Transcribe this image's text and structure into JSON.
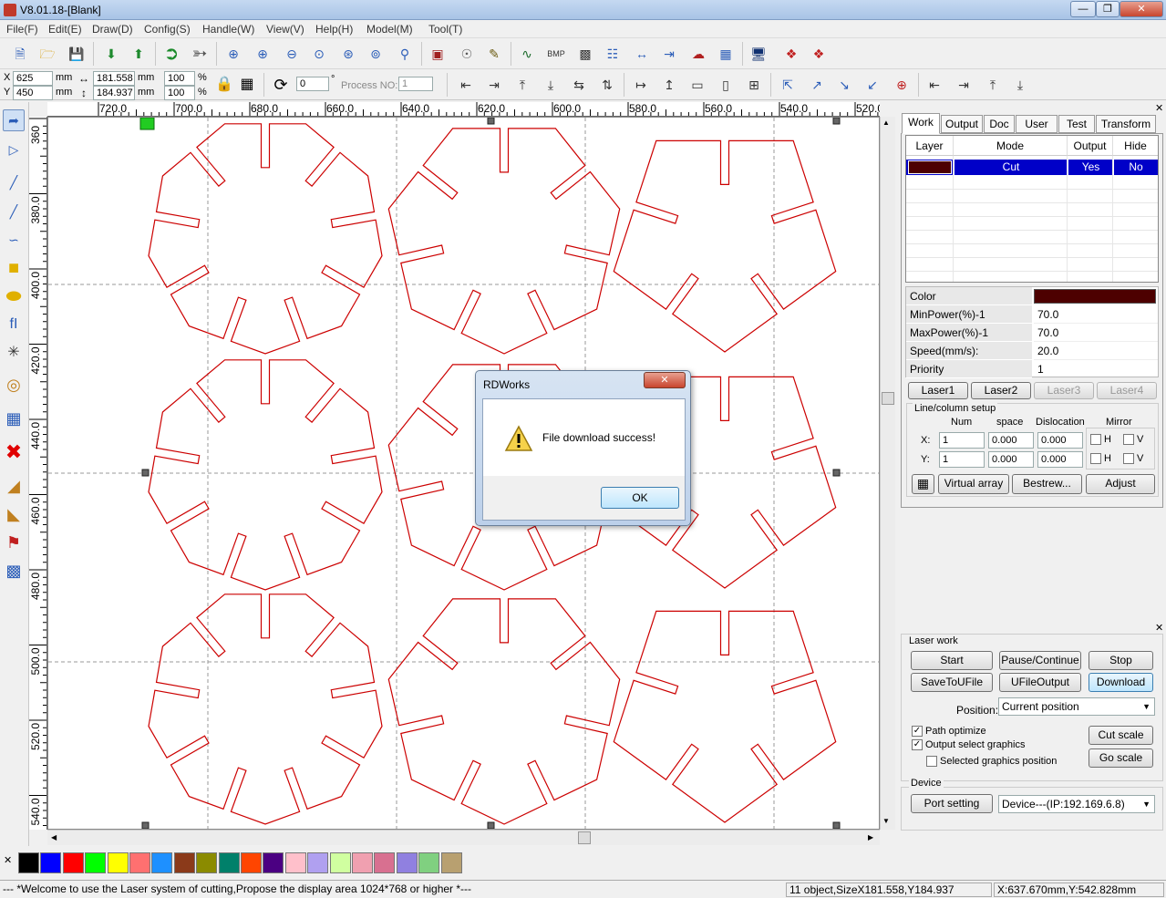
{
  "window": {
    "title": "V8.01.18-[Blank]"
  },
  "menu": [
    "File(F)",
    "Edit(E)",
    "Draw(D)",
    "Config(S)",
    "Handle(W)",
    "View(V)",
    "Help(H)",
    "Model(M)",
    "Tool(T)"
  ],
  "coords": {
    "x_label": "X",
    "x_value": "625",
    "x_unit": "mm",
    "y_label": "Y",
    "y_value": "450",
    "y_unit": "mm",
    "w_value": "181.558",
    "w_unit": "mm",
    "h_value": "184.937",
    "h_unit": "mm",
    "sx_value": "100",
    "sx_unit": "%",
    "sy_value": "100",
    "sy_unit": "%",
    "rotate_value": "0",
    "rotate_unit": "°",
    "process_label": "Process NO:",
    "process_value": "1"
  },
  "ruler_top": [
    "720.0",
    "700.0",
    "680.0",
    "660.0",
    "640.0",
    "620.0",
    "600.0",
    "580.0",
    "560.0",
    "540.0",
    "520.0"
  ],
  "ruler_left": [
    "360",
    "380.0",
    "400.0",
    "420.0",
    "440.0",
    "460.0",
    "480.0",
    "500.0",
    "520.0",
    "540.0"
  ],
  "tabs": [
    "Work",
    "Output",
    "Doc",
    "User",
    "Test",
    "Transform"
  ],
  "layer_table": {
    "headers": [
      "Layer",
      "Mode",
      "Output",
      "Hide"
    ],
    "row": {
      "color": "#4d0000",
      "mode": "Cut",
      "output": "Yes",
      "hide": "No"
    }
  },
  "props": [
    {
      "label": "Color",
      "value": ""
    },
    {
      "label": "MinPower(%)-1",
      "value": "70.0"
    },
    {
      "label": "MaxPower(%)-1",
      "value": "70.0"
    },
    {
      "label": "Speed(mm/s):",
      "value": "20.0"
    },
    {
      "label": "Priority",
      "value": "1"
    }
  ],
  "laser_buttons": [
    "Laser1",
    "Laser2",
    "Laser3",
    "Laser4"
  ],
  "array_setup": {
    "title": "Line/column setup",
    "col_num": "Num",
    "col_space": "space",
    "col_dislocation": "Dislocation",
    "col_mirror": "Mirror",
    "x_label": "X:",
    "x_num": "1",
    "x_space": "0.000",
    "x_disl": "0.000",
    "y_label": "Y:",
    "y_num": "1",
    "y_space": "0.000",
    "y_disl": "0.000",
    "mirror_h": "H",
    "mirror_v": "V",
    "virtual_array": "Virtual array",
    "bestrew": "Bestrew...",
    "adjust": "Adjust"
  },
  "laser_work": {
    "title": "Laser work",
    "start": "Start",
    "pause": "Pause/Continue",
    "stop": "Stop",
    "save_ufile": "SaveToUFile",
    "ufile_output": "UFileOutput",
    "download": "Download",
    "position_label": "Position:",
    "position_value": "Current position",
    "path_optimize": "Path optimize",
    "output_select": "Output select graphics",
    "selected_position": "Selected graphics position",
    "cut_scale": "Cut scale",
    "go_scale": "Go scale",
    "device_title": "Device",
    "port_setting": "Port setting",
    "device_value": "Device---(IP:192.169.6.8)"
  },
  "palette": [
    "#000000",
    "#0000ff",
    "#ff0000",
    "#00ff00",
    "#ffff00",
    "#ff7070",
    "#1e90ff",
    "#8b3a1a",
    "#8b8b00",
    "#00806a",
    "#ff4500",
    "#4b0082",
    "#ffc0cb",
    "#b0a0f0",
    "#d0ffa0",
    "#f0a0b0",
    "#d87090",
    "#9080e0",
    "#80d080",
    "#b8a070"
  ],
  "status": {
    "welcome": "--- *Welcome to use the Laser system of cutting,Propose the display area 1024*768 or higher *---",
    "objects": "11 object,SizeX181.558,Y184.937",
    "position": "X:637.670mm,Y:542.828mm"
  },
  "dialog": {
    "title": "RDWorks",
    "message": "File download success!",
    "ok": "OK"
  },
  "colors": {
    "shape": "#cc0000",
    "selection": "#0000c8"
  }
}
